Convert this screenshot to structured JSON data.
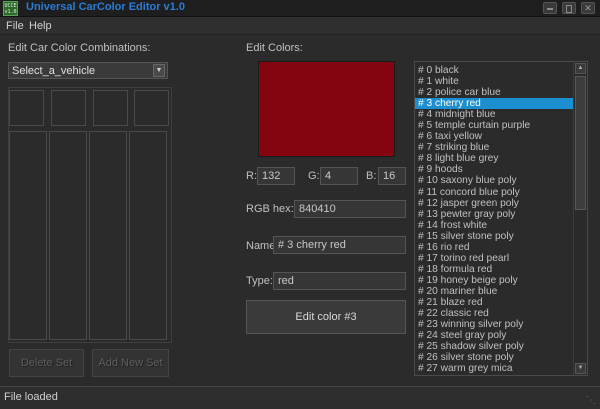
{
  "window": {
    "title": "Universal CarColor Editor v1.0",
    "icon_text": "UCCE v1.0",
    "controls": [
      "minimize-icon",
      "maximize-icon",
      "close-icon"
    ]
  },
  "menu": {
    "file": "File",
    "help": "Help"
  },
  "left_panel": {
    "heading": "Edit Car Color Combinations:",
    "vehicle_select": {
      "value": "Select_a_vehicle"
    },
    "delete_set": "Delete Set",
    "add_new_set": "Add New Set"
  },
  "editor": {
    "heading": "Edit Colors:",
    "preview_color": "#840410",
    "r_label": "R:",
    "r_value": "132",
    "g_label": "G:",
    "g_value": "4",
    "b_label": "B:",
    "b_value": "16",
    "hex_label": "RGB hex:",
    "hex_value": "840410",
    "name_label": "Name:",
    "name_value": "# 3 cherry red",
    "type_label": "Type:",
    "type_value": "red",
    "edit_button": "Edit color #3"
  },
  "color_list": {
    "selected_index": 3,
    "items": [
      "# 0 black",
      "# 1 white",
      "# 2 police car blue",
      "# 3 cherry red",
      "# 4 midnight blue",
      "# 5 temple curtain purple",
      "# 6 taxi yellow",
      "# 7 striking blue",
      "# 8 light blue grey",
      "# 9 hoods",
      "# 10 saxony blue poly",
      "# 11 concord blue poly",
      "# 12 jasper green poly",
      "# 13 pewter gray poly",
      "# 14 frost white",
      "# 15 silver stone poly",
      "# 16 rio red",
      "# 17 torino red pearl",
      "# 18 formula red",
      "# 19 honey beige poly",
      "# 20 mariner blue",
      "# 21 blaze red",
      "# 22 classic red",
      "# 23 winning silver poly",
      "# 24 steel gray poly",
      "# 25 shadow silver poly",
      "# 26 silver stone poly",
      "# 27 warm grey mica"
    ]
  },
  "status": {
    "text": "File loaded"
  }
}
